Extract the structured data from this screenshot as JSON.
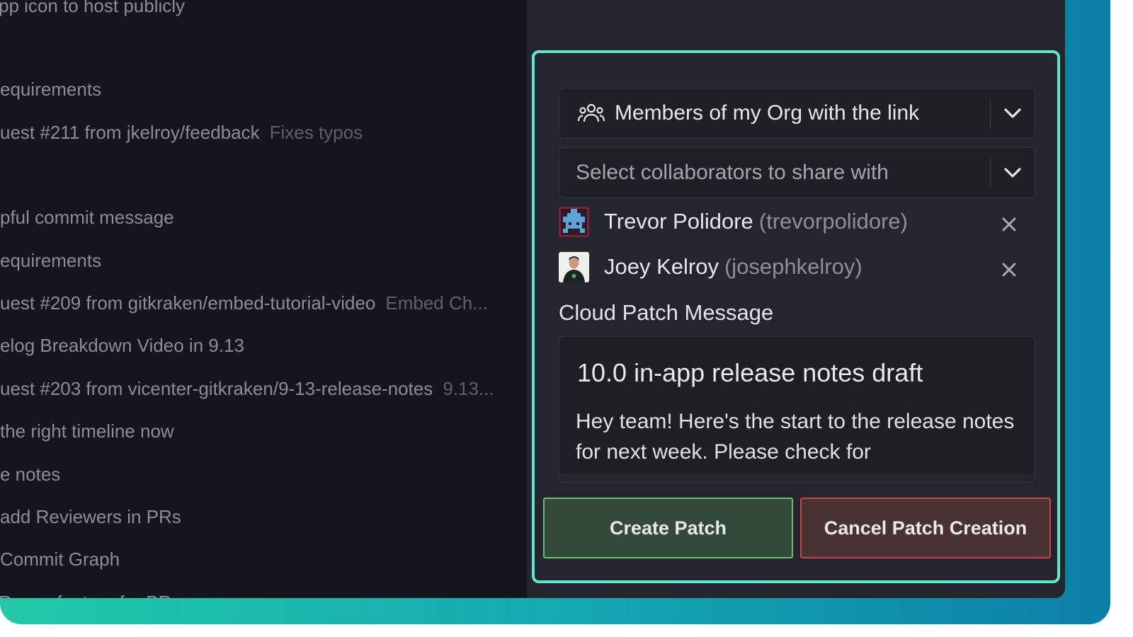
{
  "commit_list": [
    {
      "text": "pp icon to host publicly",
      "desc": ""
    },
    {
      "text": "equirements",
      "desc": ""
    },
    {
      "text": "uest #211 from jkelroy/feedback",
      "desc": "Fixes typos"
    },
    {
      "text": "pful commit message",
      "desc": ""
    },
    {
      "text": "equirements",
      "desc": ""
    },
    {
      "text": "uest #209 from gitkraken/embed-tutorial-video",
      "desc": "Embed Ch..."
    },
    {
      "text": "elog Breakdown Video in 9.13",
      "desc": ""
    },
    {
      "text": "uest #203 from vicenter-gitkraken/9-13-release-notes",
      "desc": "9.13..."
    },
    {
      "text": " the right timeline now",
      "desc": ""
    },
    {
      "text": "e notes",
      "desc": ""
    },
    {
      "text": "add Reviewers in PRs",
      "desc": ""
    },
    {
      "text": "Commit Graph",
      "desc": ""
    },
    {
      "text": "Reuse feature for PRs",
      "desc": ""
    }
  ],
  "share": {
    "visibility_value": "Members of my Org with the link",
    "visibility_icon": "people-icon",
    "collaborators_placeholder": "Select collaborators to share with"
  },
  "collaborators": [
    {
      "name": "Trevor Polidore",
      "username": "(trevorpolidore)"
    },
    {
      "name": "Joey Kelroy",
      "username": "(josephkelroy)"
    }
  ],
  "message": {
    "label": "Cloud Patch Message",
    "title": "10.0 in-app release notes draft",
    "body": "Hey team! Here's the start to the release notes for next week. Please check for"
  },
  "buttons": {
    "create": "Create Patch",
    "cancel": "Cancel Patch Creation"
  },
  "colors": {
    "accent_border": "#5ee8cf",
    "create_border": "#6cc16f",
    "cancel_border": "#c4484a"
  }
}
